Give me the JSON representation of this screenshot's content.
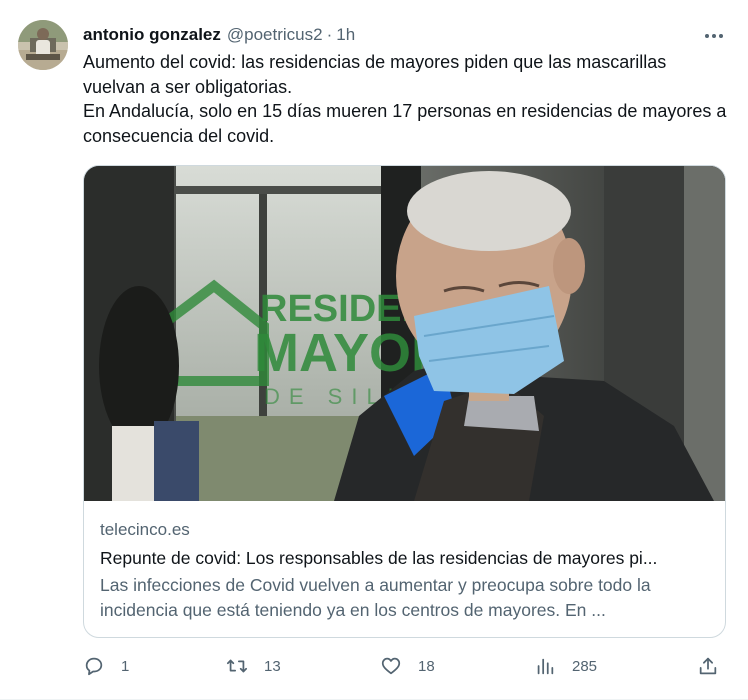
{
  "tweet": {
    "author_name": "antonio gonzalez",
    "author_handle": "@poetricus2",
    "separator": "·",
    "time": "1h",
    "text_line1": "Aumento del covid: las residencias de mayores piden que las mascarillas vuelvan a ser obligatorias.",
    "text_line2": "En Andalucía, solo en 15 días mueren 17 personas en residencias de mayores a consecuencia del covid."
  },
  "card": {
    "image_sign_line1": "RESIDENCIA",
    "image_sign_line2": "MAYOR",
    "image_sign_line3": "DE SILL",
    "domain": "telecinco.es",
    "title": "Repunte de covid: Los responsables de las residencias de mayores pi...",
    "description": "Las infecciones de Covid vuelven a aumentar y preocupa sobre todo la incidencia que está teniendo ya en los centros de mayores. En ..."
  },
  "actions": {
    "replies": "1",
    "retweets": "13",
    "likes": "18",
    "views": "285"
  },
  "icons": {
    "more": "more-dots-icon",
    "reply": "reply-icon",
    "retweet": "retweet-icon",
    "like": "heart-icon",
    "views": "views-chart-icon",
    "share": "share-icon"
  },
  "colors": {
    "text": "#0f1419",
    "secondary": "#536471",
    "border": "#cfd9de",
    "sign_green": "#2f8a3a"
  }
}
